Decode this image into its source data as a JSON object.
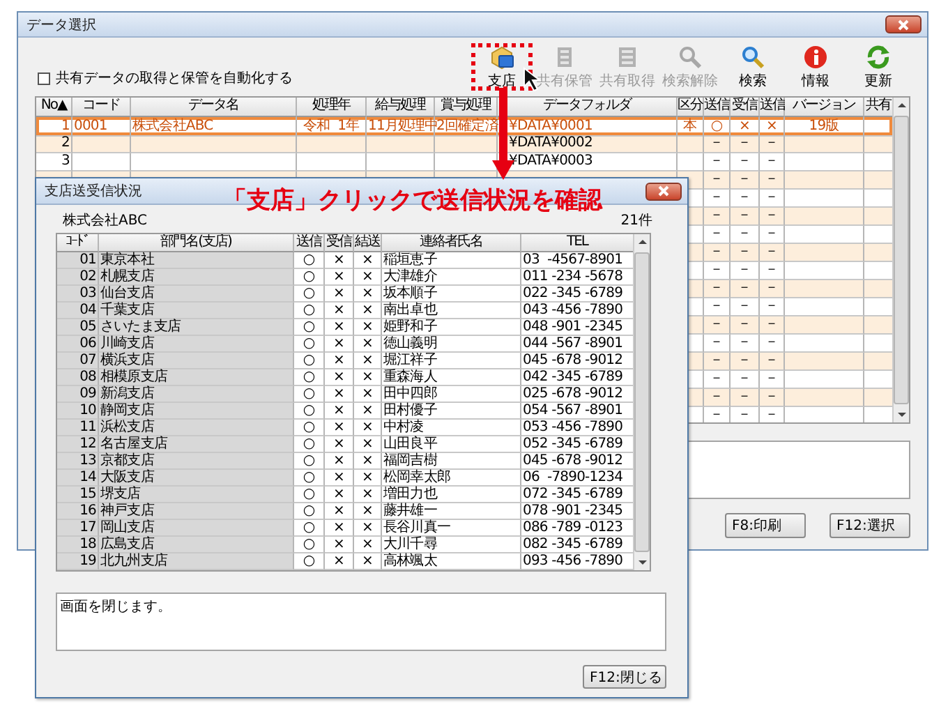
{
  "main_window": {
    "title": "データ選択",
    "auto_share": {
      "label": "共有データの取得と保管を自動化する",
      "checked": false
    },
    "toolbar": [
      {
        "kind": "branch",
        "label": "支店",
        "disabled": false,
        "highlighted": true
      },
      {
        "kind": "store",
        "label": "共有保管",
        "disabled": true,
        "highlighted": false
      },
      {
        "kind": "fetch",
        "label": "共有取得",
        "disabled": true,
        "highlighted": false
      },
      {
        "kind": "clear_search",
        "label": "検索解除",
        "disabled": true,
        "highlighted": false
      },
      {
        "kind": "search",
        "label": "検索",
        "disabled": false,
        "highlighted": false
      },
      {
        "kind": "info",
        "label": "情報",
        "disabled": false,
        "highlighted": false
      },
      {
        "kind": "refresh",
        "label": "更新",
        "disabled": false,
        "highlighted": false
      }
    ],
    "table": {
      "columns": [
        "No▲",
        "コード",
        "データ名",
        "処理年",
        "給与処理",
        "賞与処理",
        "データフォルダ",
        "区分",
        "送信",
        "受信",
        "送信",
        "バージョン",
        "共有"
      ],
      "rows": [
        {
          "no": "1",
          "code": "0001",
          "name": "株式会社ABC",
          "year": "令和  1年",
          "salary": "11月処理中",
          "bonus": "2回確定済",
          "folder": "¥DATA¥0001",
          "kubun": "本",
          "sent": "○",
          "received": "×",
          "sent_2": "×",
          "version": "19版",
          "selected": true
        },
        {
          "no": "2",
          "folder": "¥DATA¥0002",
          "sent": "－",
          "received": "－",
          "sent_2": "－",
          "selected": false
        },
        {
          "no": "3",
          "folder": "¥DATA¥0003",
          "sent": "－",
          "received": "－",
          "sent_2": "－",
          "selected": false
        },
        {
          "sent": "－",
          "received": "－",
          "sent_2": "－",
          "selected": false
        },
        {
          "sent": "－",
          "received": "－",
          "sent_2": "－",
          "selected": false
        },
        {
          "sent": "－",
          "received": "－",
          "sent_2": "－",
          "selected": false
        },
        {
          "sent": "－",
          "received": "－",
          "sent_2": "－",
          "selected": false
        },
        {
          "sent": "－",
          "received": "－",
          "sent_2": "－",
          "selected": false
        },
        {
          "sent": "－",
          "received": "－",
          "sent_2": "－",
          "selected": false
        },
        {
          "sent": "－",
          "received": "－",
          "sent_2": "－",
          "selected": false
        },
        {
          "sent": "－",
          "received": "－",
          "sent_2": "－",
          "selected": false
        },
        {
          "sent": "－",
          "received": "－",
          "sent_2": "－",
          "selected": false
        },
        {
          "sent": "－",
          "received": "－",
          "sent_2": "－",
          "selected": false
        },
        {
          "sent": "－",
          "received": "－",
          "sent_2": "－",
          "selected": false
        },
        {
          "sent": "－",
          "received": "－",
          "sent_2": "－",
          "selected": false
        },
        {
          "sent": "－",
          "received": "－",
          "sent_2": "－",
          "selected": false
        },
        {
          "sent": "－",
          "received": "－",
          "sent_2": "－",
          "selected": false
        }
      ]
    },
    "buttons": [
      "F8:印刷",
      "F12:選択"
    ]
  },
  "dialog": {
    "title": "支店送受信状況",
    "company": "株式会社ABC",
    "count": "21件",
    "table": {
      "columns": [
        "ｺｰﾄﾞ",
        "部門名(支店)",
        "送信",
        "受信",
        "結送",
        "連絡者氏名",
        "TEL"
      ],
      "rows": [
        {
          "code": "01",
          "branch": "東京本社",
          "sent": "○",
          "received": "×",
          "resent": "×",
          "contact": "稲垣恵子",
          "tel": "03  -4567-8901"
        },
        {
          "code": "02",
          "branch": "札幌支店",
          "sent": "○",
          "received": "×",
          "resent": "×",
          "contact": "大津雄介",
          "tel": "011 -234 -5678"
        },
        {
          "code": "03",
          "branch": "仙台支店",
          "sent": "○",
          "received": "×",
          "resent": "×",
          "contact": "坂本順子",
          "tel": "022 -345 -6789"
        },
        {
          "code": "04",
          "branch": "千葉支店",
          "sent": "○",
          "received": "×",
          "resent": "×",
          "contact": "南出卓也",
          "tel": "043 -456 -7890"
        },
        {
          "code": "05",
          "branch": "さいたま支店",
          "sent": "○",
          "received": "×",
          "resent": "×",
          "contact": "姫野和子",
          "tel": "048 -901 -2345"
        },
        {
          "code": "06",
          "branch": "川崎支店",
          "sent": "○",
          "received": "×",
          "resent": "×",
          "contact": "徳山義明",
          "tel": "044 -567 -8901"
        },
        {
          "code": "07",
          "branch": "横浜支店",
          "sent": "○",
          "received": "×",
          "resent": "×",
          "contact": "堀江祥子",
          "tel": "045 -678 -9012"
        },
        {
          "code": "08",
          "branch": "相模原支店",
          "sent": "○",
          "received": "×",
          "resent": "×",
          "contact": "重森海人",
          "tel": "042 -345 -6789"
        },
        {
          "code": "09",
          "branch": "新潟支店",
          "sent": "○",
          "received": "×",
          "resent": "×",
          "contact": "田中四郎",
          "tel": "025 -678 -9012"
        },
        {
          "code": "10",
          "branch": "静岡支店",
          "sent": "○",
          "received": "×",
          "resent": "×",
          "contact": "田村優子",
          "tel": "054 -567 -8901"
        },
        {
          "code": "11",
          "branch": "浜松支店",
          "sent": "○",
          "received": "×",
          "resent": "×",
          "contact": "中村凌",
          "tel": "053 -456 -7890"
        },
        {
          "code": "12",
          "branch": "名古屋支店",
          "sent": "○",
          "received": "×",
          "resent": "×",
          "contact": "山田良平",
          "tel": "052 -345 -6789"
        },
        {
          "code": "13",
          "branch": "京都支店",
          "sent": "○",
          "received": "×",
          "resent": "×",
          "contact": "福岡吉樹",
          "tel": "045 -678 -9012"
        },
        {
          "code": "14",
          "branch": "大阪支店",
          "sent": "○",
          "received": "×",
          "resent": "×",
          "contact": "松岡幸太郎",
          "tel": "06  -7890-1234"
        },
        {
          "code": "15",
          "branch": "堺支店",
          "sent": "○",
          "received": "×",
          "resent": "×",
          "contact": "増田力也",
          "tel": "072 -345 -6789"
        },
        {
          "code": "16",
          "branch": "神戸支店",
          "sent": "○",
          "received": "×",
          "resent": "×",
          "contact": "藤井雄一",
          "tel": "078 -901 -2345"
        },
        {
          "code": "17",
          "branch": "岡山支店",
          "sent": "○",
          "received": "×",
          "resent": "×",
          "contact": "長谷川真一",
          "tel": "086 -789 -0123"
        },
        {
          "code": "18",
          "branch": "広島支店",
          "sent": "○",
          "received": "×",
          "resent": "×",
          "contact": "大川千尋",
          "tel": "082 -345 -6789"
        },
        {
          "code": "19",
          "branch": "北九州支店",
          "sent": "○",
          "received": "×",
          "resent": "×",
          "contact": "高林颯太",
          "tel": "093 -456 -7890"
        }
      ]
    },
    "message": "画面を閉じます。",
    "button": "F12:閉じる"
  },
  "callout": {
    "text": "「支店」クリックで送信状況を確認"
  }
}
